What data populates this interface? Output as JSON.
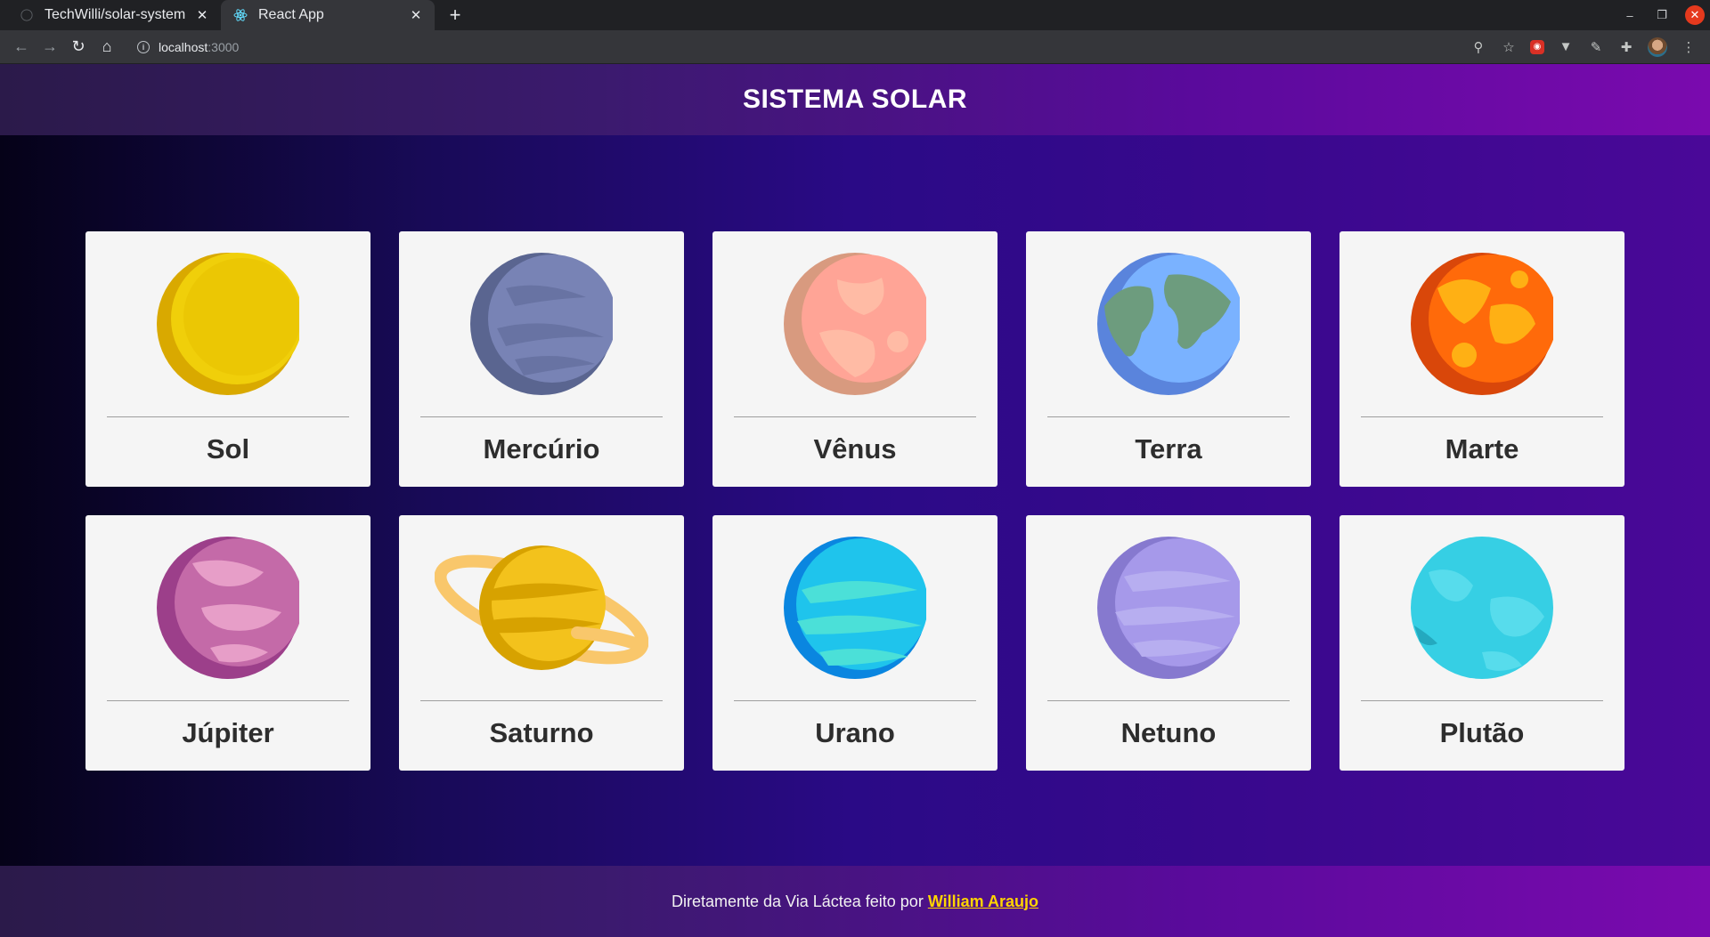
{
  "browser": {
    "tabs": [
      {
        "title": "TechWilli/solar-system",
        "active": false,
        "icon": "github-icon"
      },
      {
        "title": "React App",
        "active": true,
        "icon": "react-icon"
      }
    ],
    "url_host": "localhost",
    "url_port": ":3000"
  },
  "header": {
    "title": "SISTEMA SOLAR"
  },
  "planets": [
    {
      "name": "Sol",
      "colors": [
        "#f2d40a",
        "#d9b000"
      ]
    },
    {
      "name": "Mercúrio",
      "colors": [
        "#7b86b6",
        "#55608f"
      ]
    },
    {
      "name": "Vênus",
      "colors": [
        "#ffa89a",
        "#e88d84"
      ]
    },
    {
      "name": "Terra",
      "colors": [
        "#7aaaf8",
        "#5b86e0"
      ]
    },
    {
      "name": "Marte",
      "colors": [
        "#ff7a1a",
        "#e04800"
      ]
    },
    {
      "name": "Júpiter",
      "colors": [
        "#c66ba8",
        "#9c3d86"
      ]
    },
    {
      "name": "Saturno",
      "colors": [
        "#f7c72c",
        "#d9a300"
      ]
    },
    {
      "name": "Urano",
      "colors": [
        "#2fd6ee",
        "#0aa8e0"
      ]
    },
    {
      "name": "Netuno",
      "colors": [
        "#a89ae8",
        "#8576cf"
      ]
    },
    {
      "name": "Plutão",
      "colors": [
        "#3fd3e6",
        "#24bcd6"
      ]
    }
  ],
  "footer": {
    "text": "Diretamente da Via Láctea feito por",
    "link": "William Araujo"
  }
}
